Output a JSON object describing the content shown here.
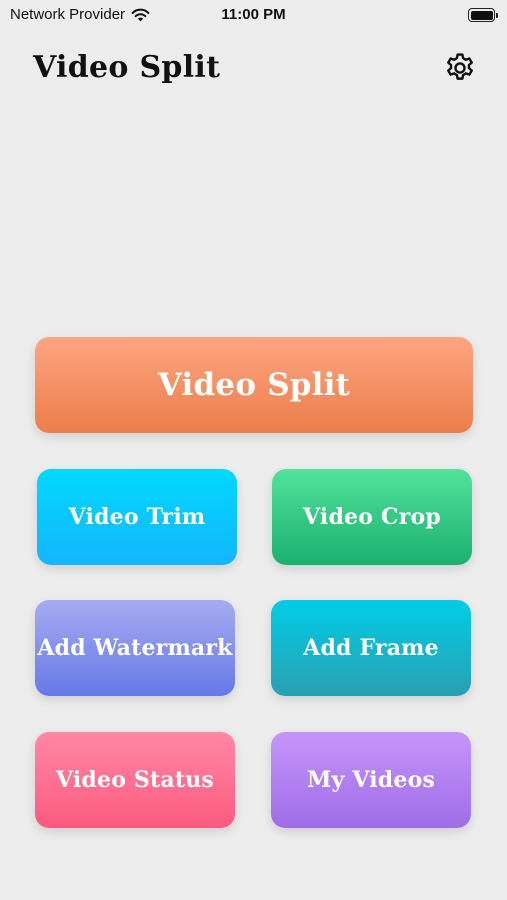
{
  "status_bar": {
    "carrier": "Network Provider",
    "time": "11:00 PM",
    "wifi_icon": "wifi-icon",
    "battery_icon": "battery-icon"
  },
  "header": {
    "title": "Video Split",
    "settings_icon": "gear-icon"
  },
  "actions": {
    "main": "Video Split",
    "trim": "Video Trim",
    "crop": "Video Crop",
    "watermark": "Add Watermark",
    "frame": "Add Frame",
    "status": "Video Status",
    "my_videos": "My Videos"
  },
  "colors": {
    "background": "#ececec",
    "main": [
      "#fda580",
      "#ec7d4a"
    ],
    "trim": [
      "#00d8ff",
      "#13b6fb"
    ],
    "crop": [
      "#52e29a",
      "#1ab06f"
    ],
    "watermark": [
      "#a6abf1",
      "#6579e7"
    ],
    "frame": [
      "#00cde8",
      "#2a9fb1"
    ],
    "status": [
      "#ff88a5",
      "#fb5a7e"
    ],
    "my_videos": [
      "#c695fa",
      "#9e6ce7"
    ]
  }
}
